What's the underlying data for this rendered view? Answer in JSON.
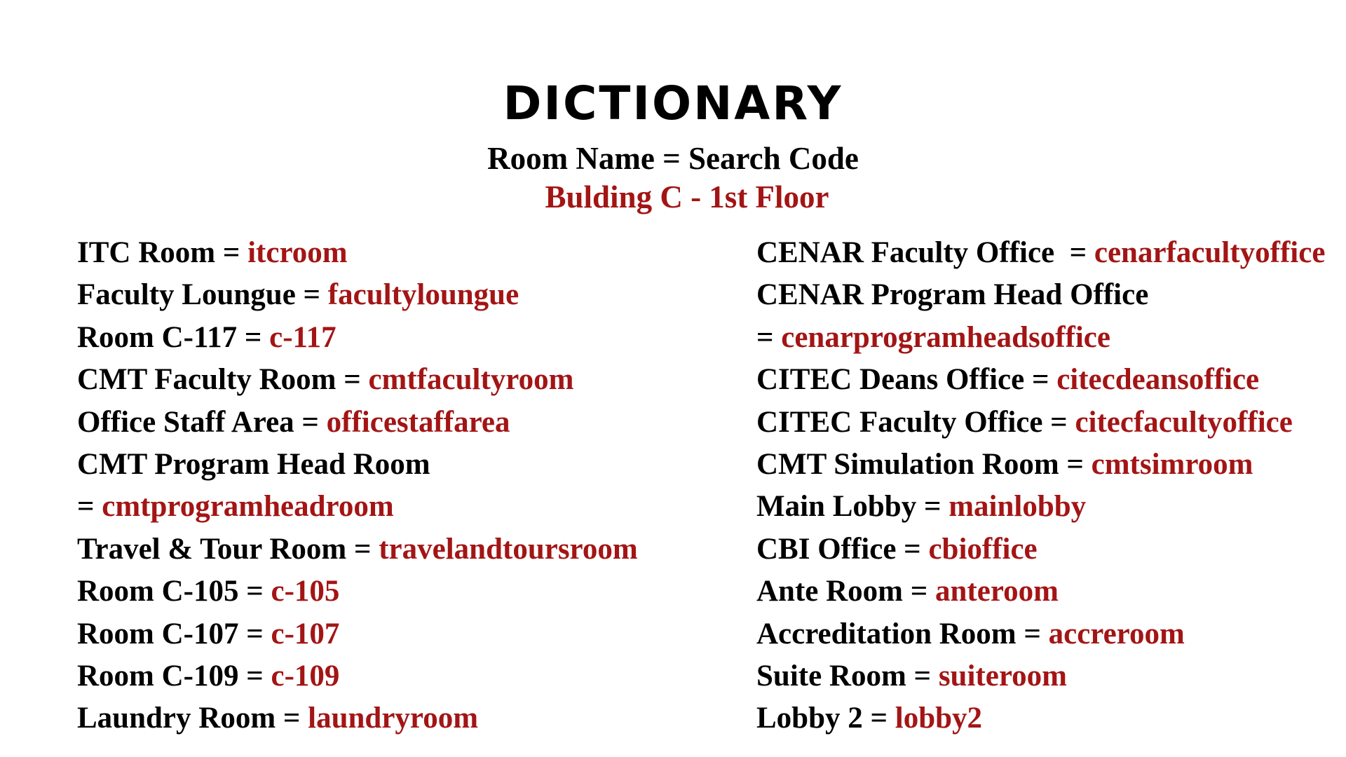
{
  "colors": {
    "text": "#000000",
    "code": "#a31515",
    "background": "#ffffff"
  },
  "title": "DICTIONARY",
  "subtitle": "Room Name = Search Code",
  "floor": "Bulding C - 1st Floor",
  "left_column": [
    {
      "name": "ITC Room = ",
      "code": "itcroom"
    },
    {
      "name": "Faculty Loungue = ",
      "code": "facultyloungue"
    },
    {
      "name": "Room C-117 = ",
      "code": "c-117"
    },
    {
      "name": "CMT Faculty Room = ",
      "code": "cmtfacultyroom"
    },
    {
      "name": "Office Staff Area = ",
      "code": "officestaffarea"
    },
    {
      "name": "CMT Program Head Room",
      "code": ""
    },
    {
      "name": "= ",
      "code": "cmtprogramheadroom"
    },
    {
      "name": "Travel & Tour Room = ",
      "code": "travelandtoursroom"
    },
    {
      "name": "Room C-105 = ",
      "code": "c-105"
    },
    {
      "name": "Room C-107 = ",
      "code": "c-107"
    },
    {
      "name": "Room C-109 = ",
      "code": "c-109"
    },
    {
      "name": "Laundry Room = ",
      "code": "laundryroom"
    }
  ],
  "right_column": [
    {
      "name": "CENAR Faculty Office  = ",
      "code": "cenarfacultyoffice"
    },
    {
      "name": "CENAR Program Head Office",
      "code": ""
    },
    {
      "name": "= ",
      "code": "cenarprogramheadsoffice"
    },
    {
      "name": "CITEC Deans Office = ",
      "code": "citecdeansoffice"
    },
    {
      "name": "CITEC Faculty Office = ",
      "code": "citecfacultyoffice"
    },
    {
      "name": "CMT Simulation Room = ",
      "code": "cmtsimroom"
    },
    {
      "name": "Main Lobby = ",
      "code": "mainlobby"
    },
    {
      "name": "CBI Office = ",
      "code": "cbioffice"
    },
    {
      "name": "Ante Room = ",
      "code": "anteroom"
    },
    {
      "name": "Accreditation Room = ",
      "code": "accreroom"
    },
    {
      "name": "Suite Room = ",
      "code": "suiteroom"
    },
    {
      "name": "Lobby 2 = ",
      "code": "lobby2"
    }
  ]
}
